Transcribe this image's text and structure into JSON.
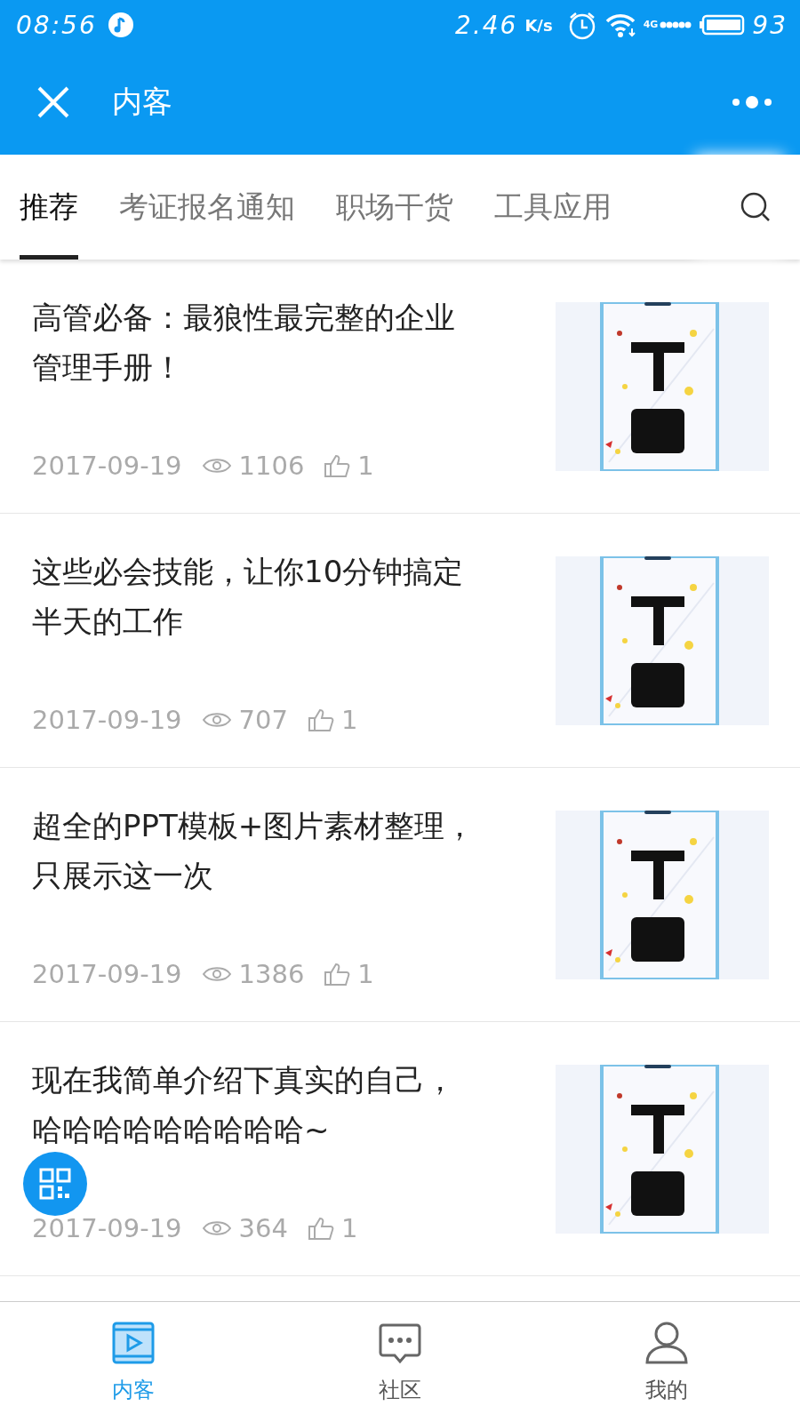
{
  "status_bar": {
    "time": "08:56",
    "speed": "2.46",
    "speed_unit": "K/s",
    "network": "4G",
    "battery": "93"
  },
  "header": {
    "title": "内客"
  },
  "tabs": [
    {
      "label": "推荐",
      "selected": true
    },
    {
      "label": "考证报名通知",
      "selected": false
    },
    {
      "label": "职场干货",
      "selected": false
    },
    {
      "label": "工具应用",
      "selected": false
    }
  ],
  "articles": [
    {
      "title": "高管必备：最狼性最完整的企业管理手册！",
      "date": "2017-09-19",
      "views": "1106",
      "likes": "1"
    },
    {
      "title": "这些必会技能，让你10分钟搞定半天的工作",
      "date": "2017-09-19",
      "views": "707",
      "likes": "1"
    },
    {
      "title": "超全的PPT模板+图片素材整理，只展示这一次",
      "date": "2017-09-19",
      "views": "1386",
      "likes": "1"
    },
    {
      "title": "现在我简单介绍下真实的自己，哈哈哈哈哈哈哈哈哈~",
      "date": "2017-09-19",
      "views": "364",
      "likes": "1"
    }
  ],
  "bottom_nav": [
    {
      "label": "内客",
      "kind": "video",
      "selected": true
    },
    {
      "label": "社区",
      "kind": "chat",
      "selected": false
    },
    {
      "label": "我的",
      "kind": "person",
      "selected": false
    }
  ]
}
